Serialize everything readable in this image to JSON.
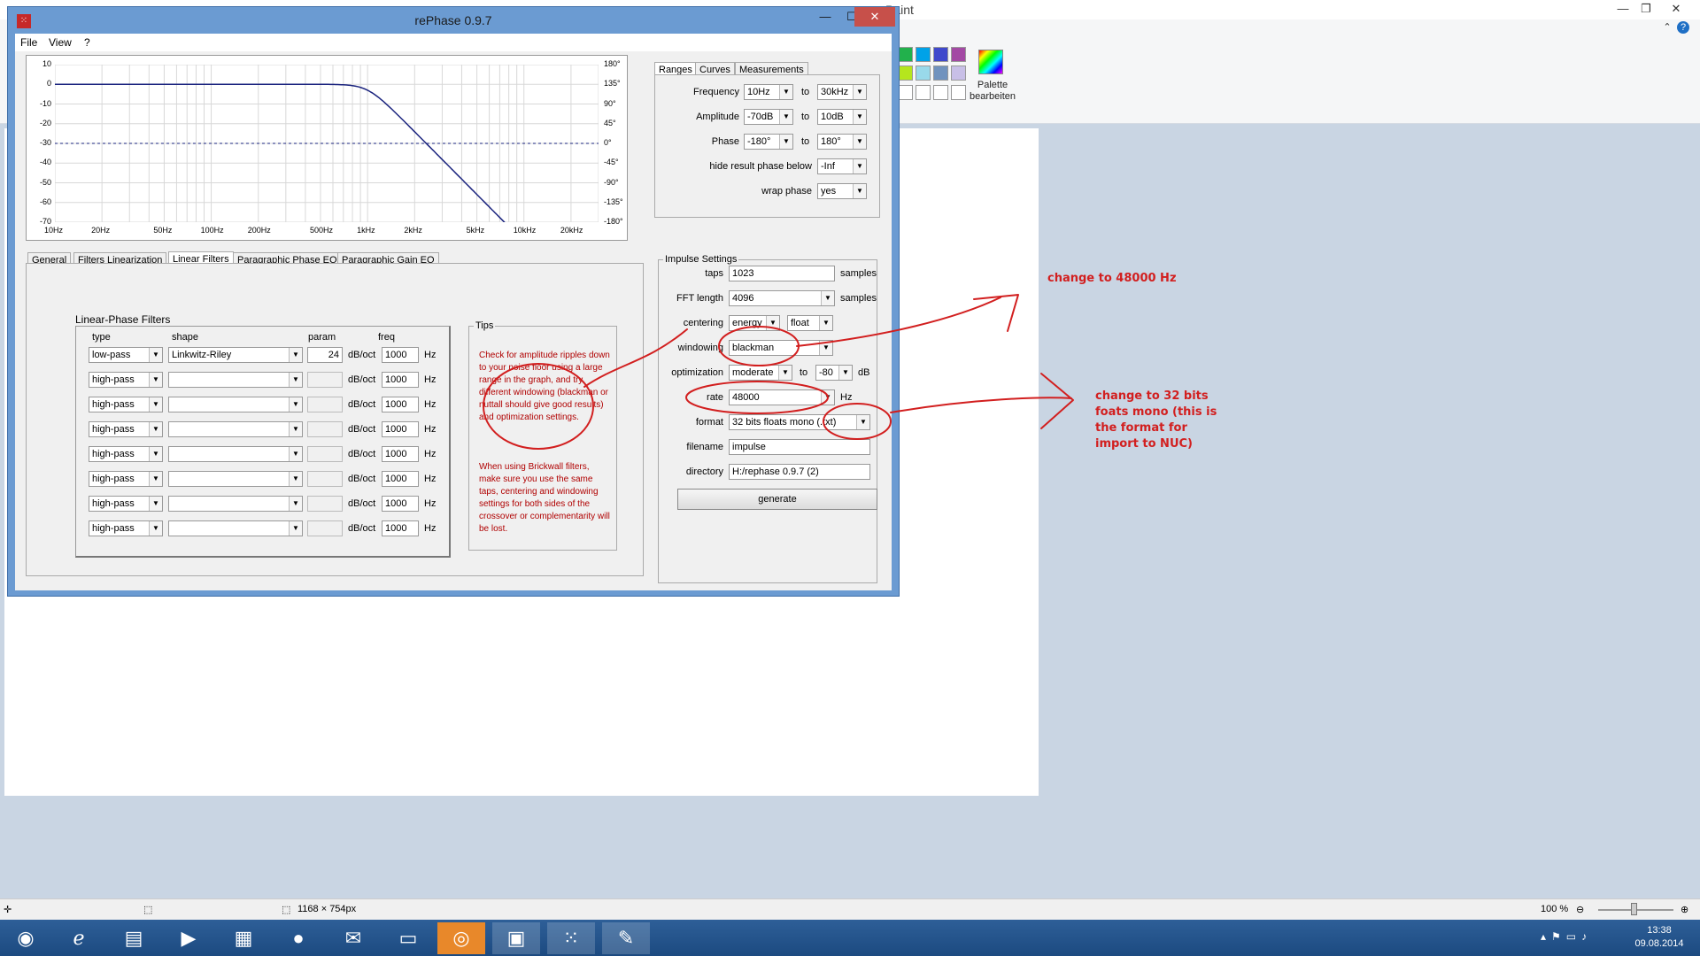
{
  "paint": {
    "title_fragment": "Paint",
    "palette_label": "Palette bearbeiten",
    "status_dims": "1168 × 754px",
    "zoom": "100 %"
  },
  "taskbar": {
    "clock_time": "13:38",
    "clock_date": "09.08.2014"
  },
  "window": {
    "title": "rePhase 0.9.7",
    "menu": [
      "File",
      "View",
      "?"
    ]
  },
  "graph": {
    "y_left": [
      "10",
      "0",
      "-10",
      "-20",
      "-30",
      "-40",
      "-50",
      "-60",
      "-70"
    ],
    "y_right": [
      "180°",
      "135°",
      "90°",
      "45°",
      "0°",
      "-45°",
      "-90°",
      "-135°",
      "-180°"
    ],
    "x_labels": [
      "10Hz",
      "20Hz",
      "50Hz",
      "100Hz",
      "200Hz",
      "500Hz",
      "1kHz",
      "2kHz",
      "5kHz",
      "10kHz",
      "20kHz"
    ]
  },
  "tabs": [
    "General",
    "Filters Linearization",
    "Linear Filters",
    "Paragraphic Phase EQ",
    "Paragraphic Gain EQ"
  ],
  "linear_filters": {
    "title": "Linear-Phase Filters",
    "col_type": "type",
    "col_shape": "shape",
    "col_param": "param",
    "col_freq": "freq",
    "unit_param": "dB/oct",
    "unit_freq": "Hz",
    "rows": [
      {
        "type": "low-pass",
        "shape": "Linkwitz-Riley",
        "param": "24",
        "freq": "1000"
      },
      {
        "type": "high-pass",
        "shape": "",
        "param": "",
        "freq": "1000"
      },
      {
        "type": "high-pass",
        "shape": "",
        "param": "",
        "freq": "1000"
      },
      {
        "type": "high-pass",
        "shape": "",
        "param": "",
        "freq": "1000"
      },
      {
        "type": "high-pass",
        "shape": "",
        "param": "",
        "freq": "1000"
      },
      {
        "type": "high-pass",
        "shape": "",
        "param": "",
        "freq": "1000"
      },
      {
        "type": "high-pass",
        "shape": "",
        "param": "",
        "freq": "1000"
      },
      {
        "type": "high-pass",
        "shape": "",
        "param": "",
        "freq": "1000"
      }
    ]
  },
  "tips": {
    "label": "Tips",
    "tip1": "Check for amplitude ripples down to your noise floor using a large range in the graph, and try different windowing (blackman or nuttall should give good results) and optimization settings.",
    "tip2": "When using Brickwall filters, make sure you use the same taps, centering and windowing settings for both sides of the crossover or complementarity will be lost."
  },
  "ranges": {
    "tabs": [
      "Ranges",
      "Curves",
      "Measurements"
    ],
    "frequency_label": "Frequency",
    "frequency_from": "10Hz",
    "frequency_to": "30kHz",
    "amplitude_label": "Amplitude",
    "amplitude_from": "-70dB",
    "amplitude_to": "10dB",
    "phase_label": "Phase",
    "phase_from": "-180°",
    "phase_to": "180°",
    "to": "to",
    "hide_label": "hide result phase below",
    "hide_value": "-Inf",
    "wrap_label": "wrap phase",
    "wrap_value": "yes"
  },
  "impulse": {
    "label": "Impulse Settings",
    "taps_label": "taps",
    "taps": "1023",
    "samples": "samples",
    "fft_label": "FFT length",
    "fft": "4096",
    "centering_label": "centering",
    "centering": "energy",
    "centering_type": "float",
    "windowing_label": "windowing",
    "windowing": "blackman",
    "optimization_label": "optimization",
    "optimization": "moderate",
    "optimization_to": "-80",
    "opt_unit": "dB",
    "rate_label": "rate",
    "rate": "48000",
    "rate_unit": "Hz",
    "format_label": "format",
    "format": "32 bits floats mono (.txt)",
    "filename_label": "filename",
    "filename": "impulse",
    "directory_label": "directory",
    "directory": "H:/rephase 0.9.7 (2)",
    "generate": "generate"
  },
  "annotations": {
    "rate_note": "change to 48000 Hz",
    "format_note": "change to 32 bits foats mono (this is the format for import to NUC)"
  },
  "colors": {
    "annotation": "#d21f1f",
    "curve": "#1a237e",
    "window_frame": "#6b9bd2"
  }
}
